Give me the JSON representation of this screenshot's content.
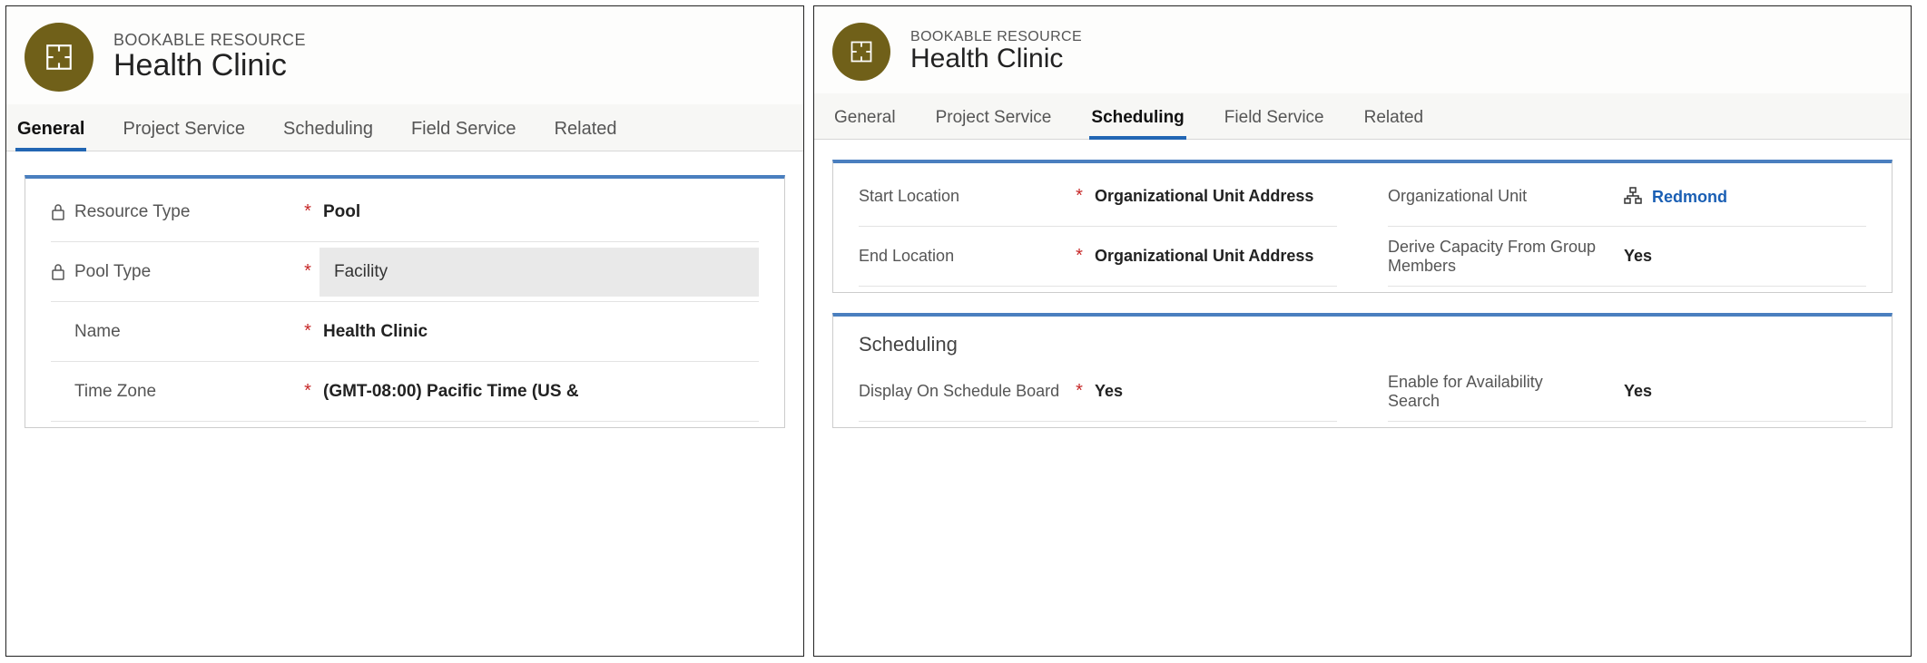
{
  "entity_label": "BOOKABLE RESOURCE",
  "entity_title": "Health Clinic",
  "tabs": {
    "general": "General",
    "project_service": "Project Service",
    "scheduling": "Scheduling",
    "field_service": "Field Service",
    "related": "Related"
  },
  "general_form": {
    "resource_type": {
      "label": "Resource Type",
      "value": "Pool"
    },
    "pool_type": {
      "label": "Pool Type",
      "value": "Facility"
    },
    "name": {
      "label": "Name",
      "value": "Health Clinic"
    },
    "time_zone": {
      "label": "Time Zone",
      "value": "(GMT-08:00) Pacific Time (US &"
    }
  },
  "scheduling_form": {
    "start_location": {
      "label": "Start Location",
      "value": "Organizational Unit Address"
    },
    "end_location": {
      "label": "End Location",
      "value": "Organizational Unit Address"
    },
    "org_unit": {
      "label": "Organizational Unit",
      "value": "Redmond"
    },
    "derive_capacity": {
      "label": "Derive Capacity From Group Members",
      "value": "Yes"
    },
    "section_title": "Scheduling",
    "display_on_board": {
      "label": "Display On Schedule Board",
      "value": "Yes"
    },
    "enable_avail": {
      "label": "Enable for Availability Search",
      "value": "Yes"
    }
  }
}
